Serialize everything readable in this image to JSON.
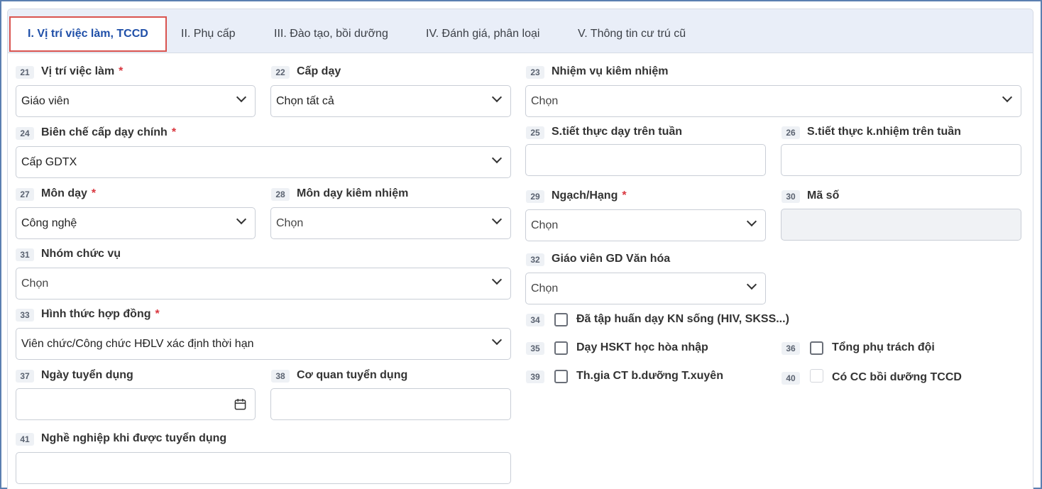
{
  "tabs": [
    {
      "label": "I. Vị trí việc làm, TCCD"
    },
    {
      "label": "II. Phụ cấp"
    },
    {
      "label": "III. Đào tạo, bồi dưỡng"
    },
    {
      "label": "IV. Đánh giá, phân loại"
    },
    {
      "label": "V. Thông tin cư trú cũ"
    }
  ],
  "fields": {
    "f21": {
      "num": "21",
      "label": "Vị trí việc làm",
      "required": "*",
      "value": "Giáo viên"
    },
    "f22": {
      "num": "22",
      "label": "Cấp dạy",
      "value": "Chọn tất cả"
    },
    "f23": {
      "num": "23",
      "label": "Nhiệm vụ kiêm nhiệm",
      "value": "Chọn"
    },
    "f24": {
      "num": "24",
      "label": "Biên chế cấp dạy chính",
      "required": "*",
      "value": "Cấp GDTX"
    },
    "f25": {
      "num": "25",
      "label": "S.tiết thực dạy trên tuần",
      "value": ""
    },
    "f26": {
      "num": "26",
      "label": "S.tiết thực k.nhiệm trên tuần",
      "value": ""
    },
    "f27": {
      "num": "27",
      "label": "Môn dạy",
      "required": "*",
      "value": "Công nghệ"
    },
    "f28": {
      "num": "28",
      "label": "Môn dạy kiêm nhiệm",
      "value": "Chọn"
    },
    "f29": {
      "num": "29",
      "label": "Ngạch/Hạng",
      "required": "*",
      "value": "Chọn"
    },
    "f30": {
      "num": "30",
      "label": "Mã số",
      "value": ""
    },
    "f31": {
      "num": "31",
      "label": "Nhóm chức vụ",
      "value": "Chọn"
    },
    "f32": {
      "num": "32",
      "label": "Giáo viên GD Văn hóa",
      "value": "Chọn"
    },
    "f33": {
      "num": "33",
      "label": "Hình thức hợp đồng",
      "required": "*",
      "value": "Viên chức/Công chức HĐLV xác định thời hạn"
    },
    "f34": {
      "num": "34",
      "label": "Đã tập huấn dạy KN sống (HIV, SKSS...)"
    },
    "f35": {
      "num": "35",
      "label": "Dạy HSKT học hòa nhập"
    },
    "f36": {
      "num": "36",
      "label": "Tổng phụ trách đội"
    },
    "f37": {
      "num": "37",
      "label": "Ngày tuyển dụng",
      "value": ""
    },
    "f38": {
      "num": "38",
      "label": "Cơ quan tuyển dụng",
      "value": ""
    },
    "f39": {
      "num": "39",
      "label": "Th.gia CT b.dưỡng T.xuyên"
    },
    "f40": {
      "num": "40",
      "label": "Có CC bồi dưỡng TCCD"
    },
    "f41": {
      "num": "41",
      "label": "Nghề nghiệp khi được tuyển dụng",
      "value": ""
    }
  },
  "colors": {
    "accent": "#1f4fa8",
    "active_tab_border": "#d9534f",
    "required": "#d9363e"
  }
}
